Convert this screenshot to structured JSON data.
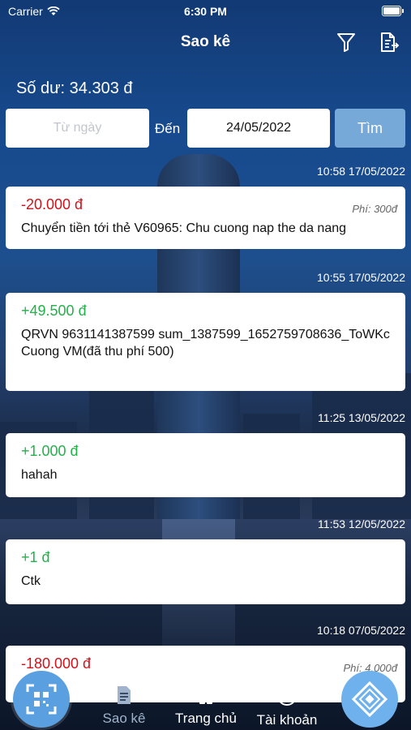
{
  "status": {
    "carrier": "Carrier",
    "time": "6:30 PM"
  },
  "header": {
    "title": "Sao kê"
  },
  "balance": {
    "text": "Số dư: 34.303 đ"
  },
  "filter": {
    "from_placeholder": "Từ ngày",
    "to_label": "Đến",
    "to_value": "24/05/2022",
    "search_label": "Tìm"
  },
  "transactions": [
    {
      "time": "10:58 17/05/2022",
      "amount": "-20.000 đ",
      "fee": "Phí: 300đ",
      "description": "Chuyển tiền tới thẻ V60965: Chu cuong nap the da nang"
    },
    {
      "time": "10:55 17/05/2022",
      "amount": "+49.500 đ",
      "fee": "",
      "description": "QRVN 9631141387599 sum_1387599_1652759708636_ToWKc Cuong VM(đã thu phí 500)"
    },
    {
      "time": "11:25 13/05/2022",
      "amount": "+1.000 đ",
      "fee": "",
      "description": "hahah"
    },
    {
      "time": "11:53 12/05/2022",
      "amount": "+1 đ",
      "fee": "",
      "description": "Ctk"
    },
    {
      "time": "10:18 07/05/2022",
      "amount": "-180.000 đ",
      "fee": "Phí: 4.000đ",
      "description": ""
    }
  ],
  "tabbar": {
    "statement": "Sao kê",
    "home": "Trang chủ",
    "account": "Tài khoản"
  },
  "colors": {
    "negative": "#d0121b",
    "positive": "#22b24a",
    "search_button": "#77a9d8"
  }
}
